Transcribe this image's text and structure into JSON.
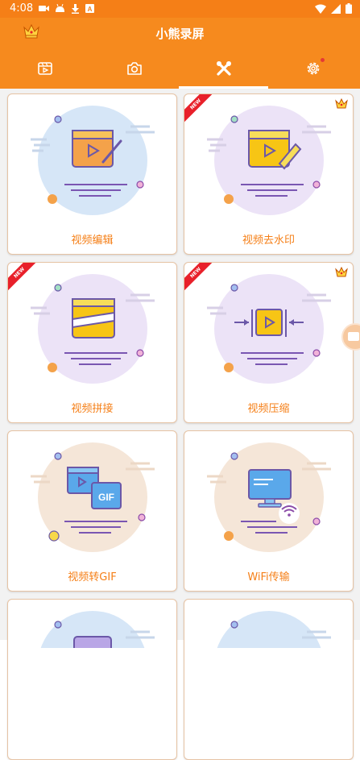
{
  "status_bar": {
    "time": "4:08"
  },
  "app_bar": {
    "title": "小熊录屏"
  },
  "tabs": [
    {
      "icon": "video-clip-icon",
      "selected": false
    },
    {
      "icon": "camera-icon",
      "selected": false
    },
    {
      "icon": "tools-icon",
      "selected": true
    },
    {
      "icon": "settings-gear-icon",
      "selected": false,
      "notification_dot": true
    }
  ],
  "tools": [
    {
      "label": "视频编辑",
      "badge_new": false,
      "vip": false
    },
    {
      "label": "视频去水印",
      "badge_new": true,
      "vip": true
    },
    {
      "label": "视频拼接",
      "badge_new": true,
      "vip": false
    },
    {
      "label": "视频压缩",
      "badge_new": true,
      "vip": true
    },
    {
      "label": "视频转GIF",
      "badge_new": false,
      "vip": false
    },
    {
      "label": "WiFi传输",
      "badge_new": false,
      "vip": false
    }
  ],
  "badges": {
    "new": "NEW",
    "gif": "GIF"
  },
  "colors": {
    "accent": "#f68a1e",
    "status_bar": "#f57f17",
    "label": "#f57f17",
    "ribbon": "#e8202a"
  }
}
